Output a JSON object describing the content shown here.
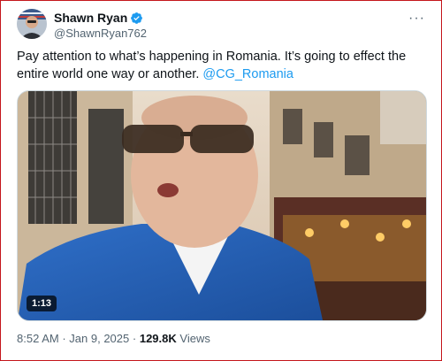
{
  "tweet": {
    "author": {
      "display_name": "Shawn Ryan",
      "handle": "@ShawnRyan762",
      "verified": true
    },
    "text_main": "Pay attention to what’s happening in Romania. It’s going to effect the entire world one way or another.",
    "mention": "@CG_Romania",
    "more_icon": "···",
    "video": {
      "duration": "1:13"
    },
    "time": "8:52 AM",
    "separator": "·",
    "date": "Jan 9, 2025",
    "views_count": "129.8K",
    "views_label": "Views"
  },
  "colors": {
    "accent": "#1d9bf0",
    "text": "#0f1419",
    "muted": "#536471",
    "frame_border": "#c4161c"
  }
}
